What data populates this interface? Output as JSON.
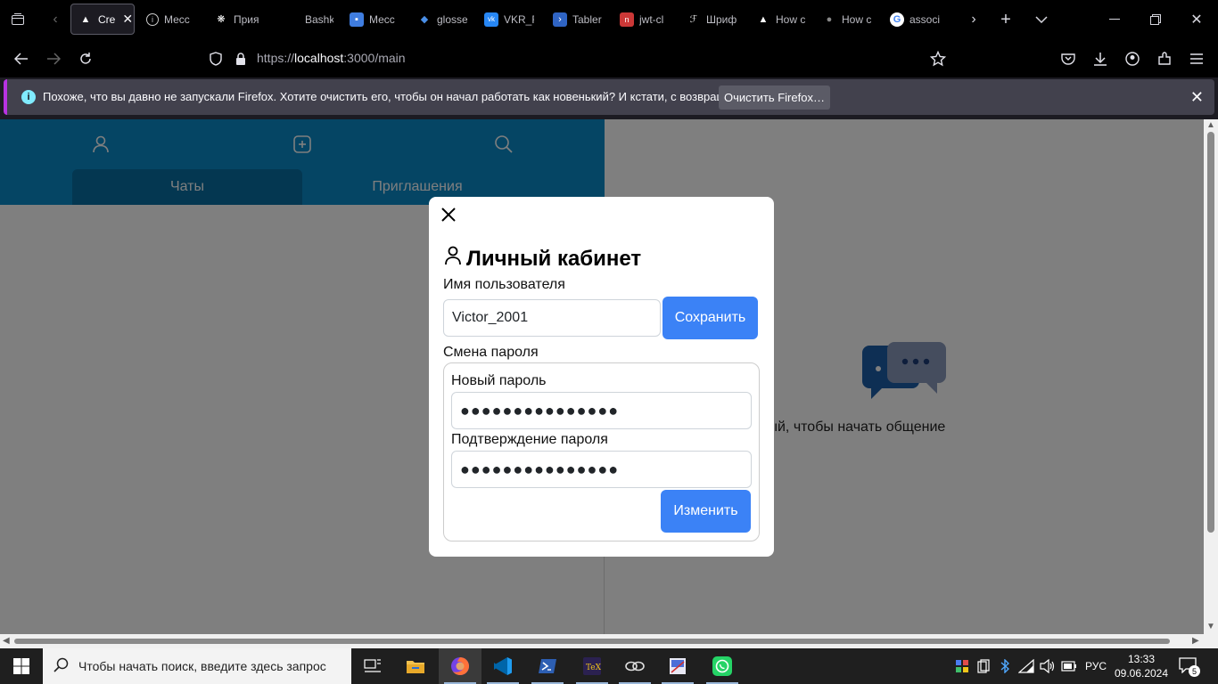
{
  "browser": {
    "tabs": [
      {
        "label": "Cre",
        "favicon": "triangle-icon",
        "active": true
      },
      {
        "label": "Месс",
        "favicon": "info-icon"
      },
      {
        "label": "Прия",
        "favicon": "openai-icon"
      },
      {
        "label": "Bashkirev_",
        "favicon": "none"
      },
      {
        "label": "Месс",
        "favicon": "chat-icon"
      },
      {
        "label": "glosse",
        "favicon": "shield-icon"
      },
      {
        "label": "VKR_F",
        "favicon": "vk-icon"
      },
      {
        "label": "Tabler",
        "favicon": "terminal-icon"
      },
      {
        "label": "jwt-cl",
        "favicon": "package-icon"
      },
      {
        "label": "Шриф",
        "favicon": "font-icon"
      },
      {
        "label": "How c",
        "favicon": "triangle-icon"
      },
      {
        "label": "How c",
        "favicon": "github-icon"
      },
      {
        "label": "associ",
        "favicon": "google-icon"
      }
    ],
    "url_prefix": "https://",
    "url_host": "localhost",
    "url_path": ":3000/main",
    "notification": {
      "info": "i",
      "text": "Похоже, что вы давно не запускали Firefox. Хотите очистить его, чтобы он начал работать как новенький? И кстати, с возвращением!",
      "button": "Очистить Firefox…"
    }
  },
  "app": {
    "tabs": [
      {
        "label": "Чаты",
        "active": true
      },
      {
        "label": "Приглашения",
        "active": false
      }
    ],
    "empty_message": "Выберите чат из списка или создайте новый, чтобы начать общение"
  },
  "modal": {
    "title": "Личный кабинет",
    "username_label": "Имя пользователя",
    "username_value": "Victor_2001",
    "save_button": "Сохранить",
    "password_section_label": "Смена пароля",
    "new_password_label": "Новый пароль",
    "new_password_value": "●●●●●●●●●●●●●●●",
    "confirm_password_label": "Подтверждение пароля",
    "confirm_password_value": "●●●●●●●●●●●●●●●",
    "change_button": "Изменить"
  },
  "taskbar": {
    "search_placeholder": "Чтобы начать поиск, введите здесь запрос",
    "language": "РУС",
    "time": "13:33",
    "date": "09.06.2024",
    "notifications_count": "5",
    "apps": [
      "task-view-icon",
      "file-explorer-icon",
      "firefox-icon",
      "vscode-icon",
      "powershell-icon",
      "texstudio-icon",
      "network-app-icon",
      "snipping-tool-icon",
      "whatsapp-icon"
    ]
  },
  "colors": {
    "accent_blue": "#3b82f6",
    "header_blue": "#0a8ac8",
    "active_tab_blue": "#086fa2"
  }
}
